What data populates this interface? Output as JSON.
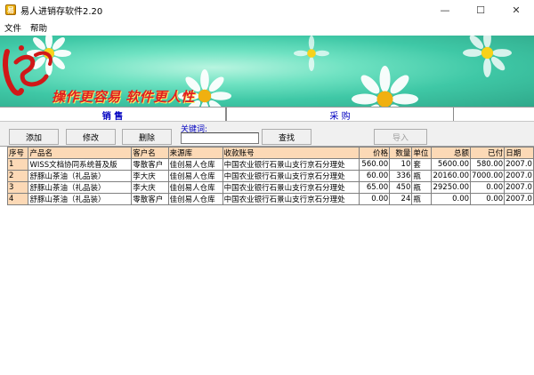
{
  "window": {
    "title": "易人进销存软件2.20",
    "controls": {
      "minimize": "—",
      "maximize": "☐",
      "close": "✕"
    }
  },
  "menu": {
    "items": [
      "文件",
      "帮助"
    ]
  },
  "banner": {
    "slogan": "操作更容易  软件更人性"
  },
  "tabs": [
    {
      "label": "销 售",
      "active": true
    },
    {
      "label": "采 购",
      "active": false
    }
  ],
  "toolbar": {
    "add_label": "添加",
    "edit_label": "修改",
    "delete_label": "删除",
    "keyword_label": "关键词:",
    "keyword_value": "",
    "search_label": "查找",
    "import_label": "导入"
  },
  "table": {
    "columns": [
      "序号",
      "产品名",
      "客户名",
      "来源库",
      "收款账号",
      "价格",
      "数量",
      "单位",
      "总额",
      "已付",
      "日期"
    ],
    "rows": [
      [
        "1",
        "WISS文档协同系统普及版",
        "零散客户",
        "佳创易人仓库",
        "中国农业银行石景山支行京石分理处",
        "560.00",
        "10",
        "套",
        "5600.00",
        "580.00",
        "2007.0"
      ],
      [
        "2",
        "舒豚山茶油（礼品装）",
        "李大庆",
        "佳创易人仓库",
        "中国农业银行石景山支行京石分理处",
        "60.00",
        "336",
        "瓶",
        "20160.00",
        "7000.00",
        "2007.0"
      ],
      [
        "3",
        "舒豚山茶油（礼品装）",
        "李大庆",
        "佳创易人仓库",
        "中国农业银行石景山支行京石分理处",
        "65.00",
        "450",
        "瓶",
        "29250.00",
        "0.00",
        "2007.0"
      ],
      [
        "4",
        "舒豚山茶油（礼品装）",
        "零散客户",
        "佳创易人仓库",
        "中国农业银行石景山支行京石分理处",
        "0.00",
        "24",
        "瓶",
        "0.00",
        "0.00",
        "2007.0"
      ]
    ]
  }
}
